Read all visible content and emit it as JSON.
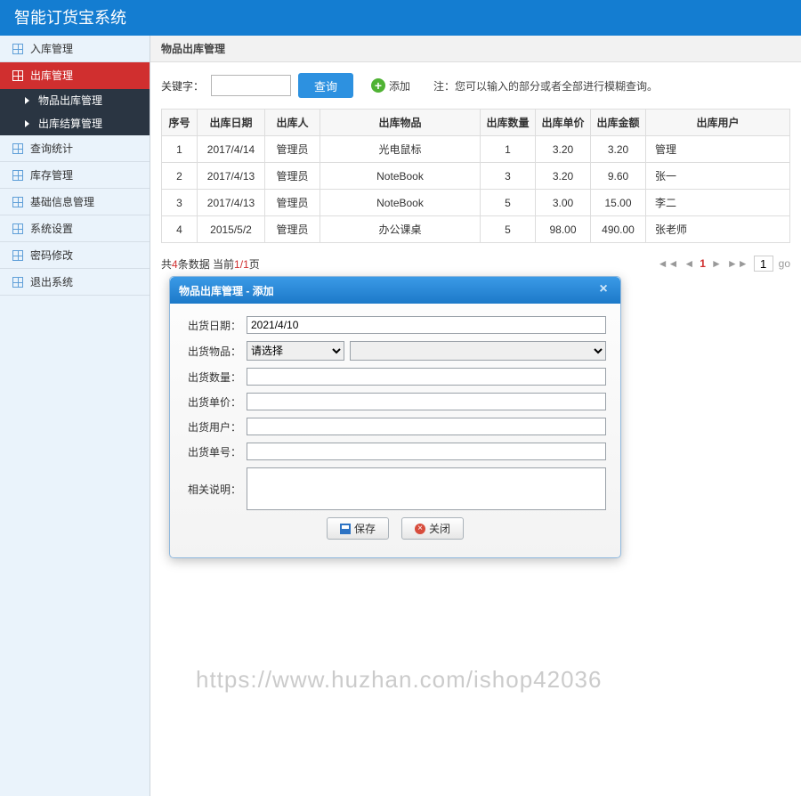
{
  "header": {
    "title": "智能订货宝系统"
  },
  "sidebar": {
    "items": [
      {
        "label": "入库管理"
      },
      {
        "label": "出库管理"
      },
      {
        "label": "查询统计"
      },
      {
        "label": "库存管理"
      },
      {
        "label": "基础信息管理"
      },
      {
        "label": "系统设置"
      },
      {
        "label": "密码修改"
      },
      {
        "label": "退出系统"
      }
    ],
    "sub": [
      {
        "label": "物品出库管理"
      },
      {
        "label": "出库结算管理"
      }
    ]
  },
  "crumb": "物品出库管理",
  "toolbar": {
    "kw_label": "关键字：",
    "query": "查询",
    "add": "添加",
    "hint": "注：您可以输入的部分或者全部进行模糊查询。"
  },
  "table": {
    "headers": [
      "序号",
      "出库日期",
      "出库人",
      "出库物品",
      "出库数量",
      "出库单价",
      "出库金额",
      "出库用户"
    ],
    "rows": [
      [
        "1",
        "2017/4/14",
        "管理员",
        "光电鼠标",
        "1",
        "3.20",
        "3.20",
        "管理"
      ],
      [
        "2",
        "2017/4/13",
        "管理员",
        "NoteBook",
        "3",
        "3.20",
        "9.60",
        "张一"
      ],
      [
        "3",
        "2017/4/13",
        "管理员",
        "NoteBook",
        "5",
        "3.00",
        "15.00",
        "李二"
      ],
      [
        "4",
        "2015/5/2",
        "管理员",
        "办公课桌",
        "5",
        "98.00",
        "490.00",
        "张老师"
      ]
    ]
  },
  "pager": {
    "total": "4",
    "before": "共",
    "mid": "条数据 当前",
    "page": "1",
    "sep": "/",
    "pages": "1",
    "after": "页",
    "go": "go",
    "current_input": "1"
  },
  "dialog": {
    "title": "物品出库管理 - 添加",
    "fields": {
      "date_label": "出货日期：",
      "date_value": "2021/4/10",
      "item_label": "出货物品：",
      "item_select": "请选择",
      "qty_label": "出货数量：",
      "price_label": "出货单价：",
      "user_label": "出货用户：",
      "no_label": "出货单号：",
      "desc_label": "相关说明："
    },
    "save": "保存",
    "close": "关闭"
  },
  "watermark": "https://www.huzhan.com/ishop42036"
}
